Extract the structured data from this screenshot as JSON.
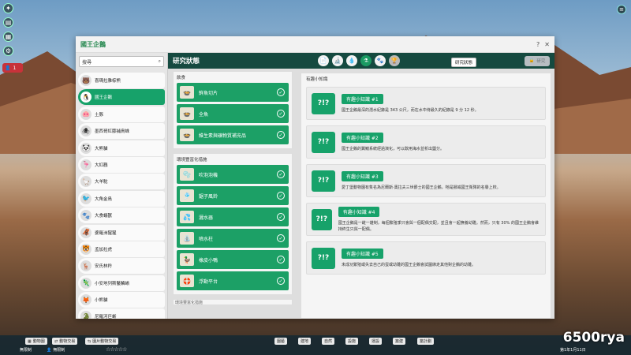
{
  "window": {
    "title": "國王企鵝",
    "help": "?",
    "close": "✕"
  },
  "search": {
    "value": "搜尋",
    "icon": "⌕"
  },
  "animals": [
    {
      "name": "喜瑪拉雅棕熊",
      "glyph": "🐻"
    },
    {
      "name": "國王企鵝",
      "glyph": "🐧",
      "selected": true
    },
    {
      "name": "土豚",
      "glyph": "🐽"
    },
    {
      "name": "墨西哥紅膝捕鳥蛛",
      "glyph": "🕷"
    },
    {
      "name": "大熊貓",
      "glyph": "🐼"
    },
    {
      "name": "大紅鸛",
      "glyph": "🦩"
    },
    {
      "name": "大羊駝",
      "glyph": "🦙"
    },
    {
      "name": "大角金鳥",
      "glyph": "🐦"
    },
    {
      "name": "大食蟻獸",
      "glyph": "🐾"
    },
    {
      "name": "婆羅洲猩猩",
      "glyph": "🦧"
    },
    {
      "name": "孟加拉虎",
      "glyph": "🐯"
    },
    {
      "name": "安氏林羚",
      "glyph": "🦌"
    },
    {
      "name": "小安地列斯鬣鱗蜥",
      "glyph": "🦎"
    },
    {
      "name": "小熊貓",
      "glyph": "🦊"
    },
    {
      "name": "尼羅河巨蜥",
      "glyph": "🐊"
    }
  ],
  "header": {
    "title": "研究狀態",
    "tooltip": "研究狀態",
    "btn": "研究"
  },
  "tabs": [
    "📄",
    "🔬",
    "💧",
    "⚗",
    "🐾",
    "🏆"
  ],
  "diet": {
    "title": "飲食",
    "items": [
      {
        "label": "鮮魚切片",
        "icon": "🍲"
      },
      {
        "label": "全魚",
        "icon": "🍲"
      },
      {
        "label": "維生素與礦物質補充品",
        "icon": "🍲"
      }
    ]
  },
  "enrich": {
    "title": "環境豐富化措施",
    "items": [
      {
        "label": "吹泡泡機",
        "icon": "🫧"
      },
      {
        "label": "鋸子風鈴",
        "icon": "🎐"
      },
      {
        "label": "灑水器",
        "icon": "💦"
      },
      {
        "label": "噴水柱",
        "icon": "⛲"
      },
      {
        "label": "橡皮小鴨",
        "icon": "🦆"
      },
      {
        "label": "浮動平台",
        "icon": "🛟"
      }
    ]
  },
  "next_section": "環境豐富化措施",
  "facts": {
    "title": "有趣小知識",
    "items": [
      {
        "label": "有趣小知識 #1",
        "text": "國王企鵝最深的潛水紀錄是 343 公尺，而在水中待最久的紀錄是 9 分 12 秒。"
      },
      {
        "label": "有趣小知識 #2",
        "text": "國王企鵝的翼鰭系統經過演化，可以飲用海水並析出鹽分。"
      },
      {
        "label": "有趣小知識 #3",
        "text": "愛丁堡動物園有隻名為尼爾斯·奧拉夫三世爵士的國王企鵝，牠是挪威國王衛隊的名譽上校。"
      },
      {
        "label": "有趣小知識 #4",
        "text": "國王企鵝是一雌一雄制，每個繁殖季只會與一個配偶交配，並且會一起撫養幼雛。然而，只有 30% 的國王企鵝會維持終生只與一配偶。"
      },
      {
        "label": "有趣小知識 #5",
        "text": "未成功繁殖或失去自己的蛋或幼雛的國王企鵝會試圖綁走其他對企鵝的幼雛。"
      }
    ]
  },
  "bottom": {
    "b1": "動物園",
    "b2": "動物交易",
    "b3": "園片動物交易",
    "unl1": "無限制",
    "unl2": "無限制",
    "tools": [
      "園藝",
      "建地",
      "自然",
      "設施",
      "運設",
      "築建",
      "築計劃"
    ],
    "date": "第1年1月11日"
  },
  "watermark": "6500rya"
}
